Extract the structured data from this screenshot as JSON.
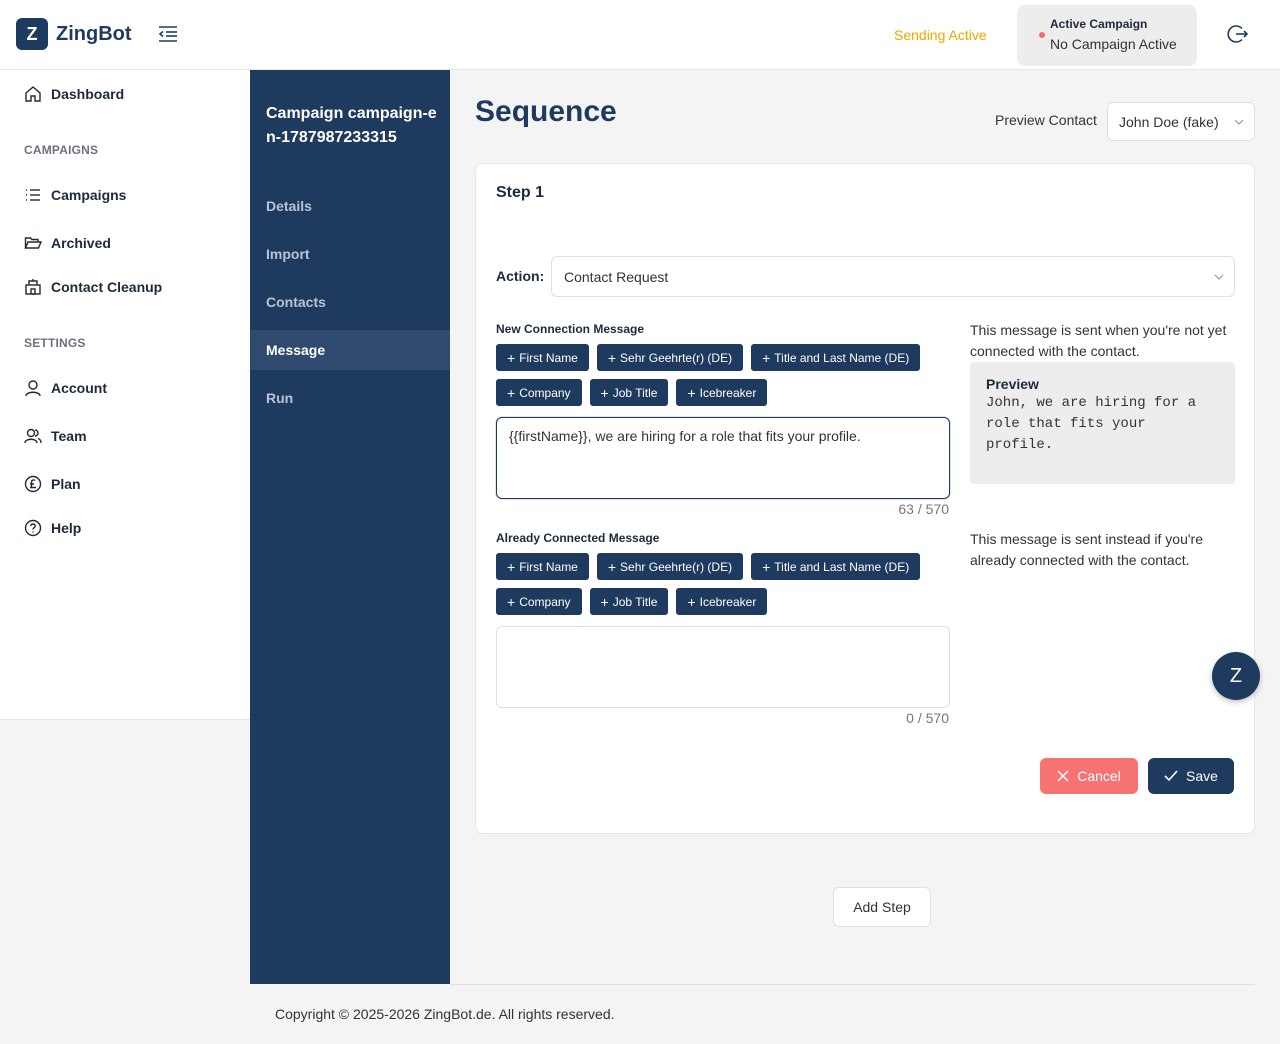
{
  "app": {
    "name": "ZingBot",
    "logo_letter": "Z"
  },
  "topbar": {
    "sending_status": "Sending Active",
    "active_campaign_label": "Active Campaign",
    "active_campaign_value": "No Campaign Active",
    "status_color": "#f0a500"
  },
  "sidebar": {
    "dashboard": "Dashboard",
    "campaigns_section": "CAMPAIGNS",
    "campaigns": "Campaigns",
    "archived": "Archived",
    "contact_cleanup": "Contact Cleanup",
    "settings_section": "SETTINGS",
    "account": "Account",
    "team": "Team",
    "plan": "Plan",
    "help": "Help"
  },
  "subnav": {
    "title": "Campaign campaign-en-1787987233315",
    "items": [
      "Details",
      "Import",
      "Contacts",
      "Message",
      "Run"
    ],
    "active": "Message"
  },
  "main": {
    "title": "Sequence",
    "preview_contact_label": "Preview Contact",
    "preview_contact_value": "John Doe (fake)"
  },
  "step": {
    "title": "Step 1",
    "action_label": "Action",
    "action_value": "Contact Request",
    "new_connection": {
      "label": "New Connection Message",
      "chips_row1": [
        "First Name",
        "Sehr Geehrte(r) (DE)",
        "Title and Last Name (DE)"
      ],
      "chips_row2": [
        "Company",
        "Job Title",
        "Icebreaker"
      ],
      "message": "{{firstName}}, we are hiring for a role that fits your profile.",
      "counter": "63 / 570",
      "hint": "This message is sent when you're not yet connected with the contact.",
      "preview_heading": "Preview",
      "preview_text": "John, we are hiring for a role that fits your profile."
    },
    "already_connected": {
      "label": "Already Connected Message",
      "chips_row1": [
        "First Name",
        "Sehr Geehrte(r) (DE)",
        "Title and Last Name (DE)"
      ],
      "chips_row2": [
        "Company",
        "Job Title",
        "Icebreaker"
      ],
      "message": "",
      "counter": "0 / 570",
      "hint": "This message is sent instead if you're already connected with the contact."
    },
    "cancel_label": "Cancel",
    "save_label": "Save"
  },
  "fab_letter": "Z",
  "add_step_label": "Add Step",
  "footer": "Copyright © 2025-2026 ZingBot.de. All rights reserved."
}
